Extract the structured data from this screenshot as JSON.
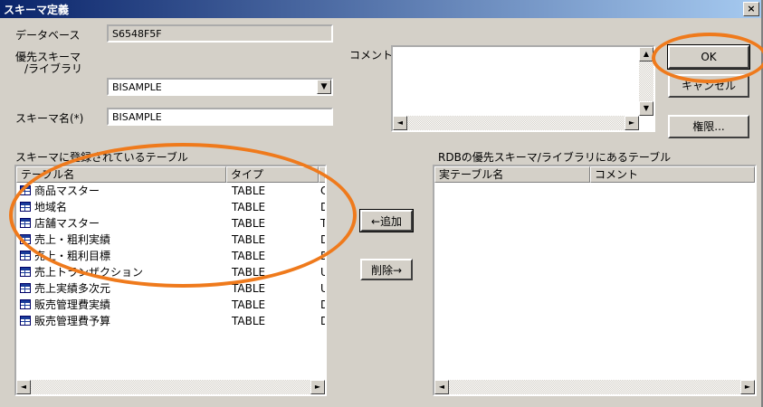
{
  "window": {
    "title": "スキーマ定義",
    "close_glyph": "×"
  },
  "form": {
    "database_label": "データベース",
    "database_value": "S6548F5F",
    "preferred_schema_label_1": "優先スキーマ",
    "preferred_schema_label_2": "/ライブラリ",
    "preferred_schema_value": "BISAMPLE",
    "schema_name_label": "スキーマ名(*)",
    "schema_name_value": "BISAMPLE",
    "comment_label": "コメント",
    "comment_value": ""
  },
  "buttons": {
    "ok": "OK",
    "cancel": "キャンセル",
    "permissions": "権限...",
    "add": "←追加",
    "delete": "削除→"
  },
  "left_list": {
    "caption": "スキーマに登録されているテーブル",
    "columns": [
      "テーブル名",
      "タイプ",
      "ヨ"
    ],
    "rows": [
      {
        "name": "商品マスター",
        "type": "TABLE",
        "extra": "C"
      },
      {
        "name": "地域名",
        "type": "TABLE",
        "extra": "D"
      },
      {
        "name": "店舗マスター",
        "type": "TABLE",
        "extra": "T"
      },
      {
        "name": "売上・粗利実績",
        "type": "TABLE",
        "extra": "D"
      },
      {
        "name": "売上・粗利目標",
        "type": "TABLE",
        "extra": "D"
      },
      {
        "name": "売上トランザクション",
        "type": "TABLE",
        "extra": "U"
      },
      {
        "name": "売上実績多次元",
        "type": "TABLE",
        "extra": "U"
      },
      {
        "name": "販売管理費実績",
        "type": "TABLE",
        "extra": "D"
      },
      {
        "name": "販売管理費予算",
        "type": "TABLE",
        "extra": "D"
      }
    ]
  },
  "right_list": {
    "caption": "RDBの優先スキーマ/ライブラリにあるテーブル",
    "columns": [
      "実テーブル名",
      "コメント"
    ],
    "rows": []
  },
  "icons": {
    "table": "table-icon",
    "dropdown": "chevron-down-icon",
    "scroll_left": "◄",
    "scroll_right": "►",
    "scroll_up": "▲",
    "scroll_down": "▼"
  },
  "colors": {
    "highlight": "#ef7a1c",
    "titlebar_start": "#0a246a",
    "titlebar_end": "#a6caf0",
    "face": "#d4d0c8"
  }
}
